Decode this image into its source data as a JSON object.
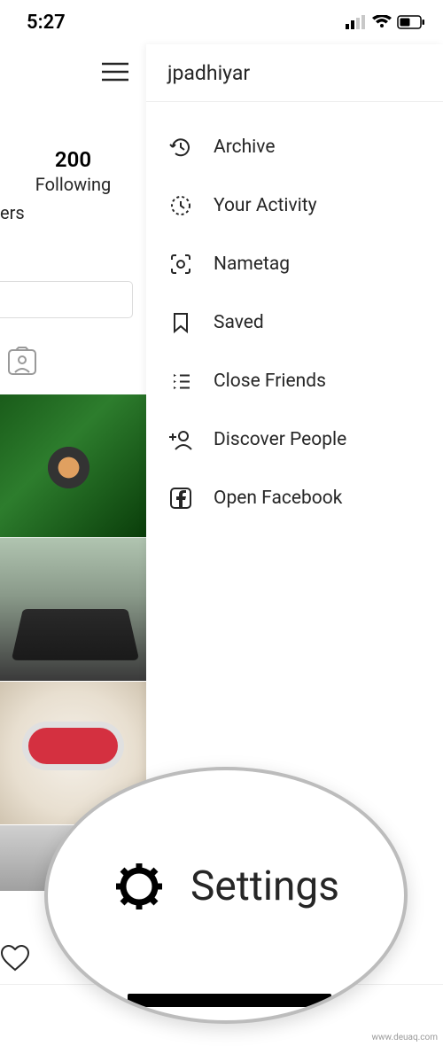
{
  "statusbar": {
    "time": "5:27"
  },
  "profile": {
    "following_count": "200",
    "following_label": "Following",
    "partial_label": "ers"
  },
  "drawer": {
    "username": "jpadhiyar",
    "items": [
      {
        "label": "Archive"
      },
      {
        "label": "Your Activity"
      },
      {
        "label": "Nametag"
      },
      {
        "label": "Saved"
      },
      {
        "label": "Close Friends"
      },
      {
        "label": "Discover People"
      },
      {
        "label": "Open Facebook"
      }
    ]
  },
  "magnifier": {
    "settings_label": "Settings"
  },
  "watermark": "www.deuaq.com"
}
